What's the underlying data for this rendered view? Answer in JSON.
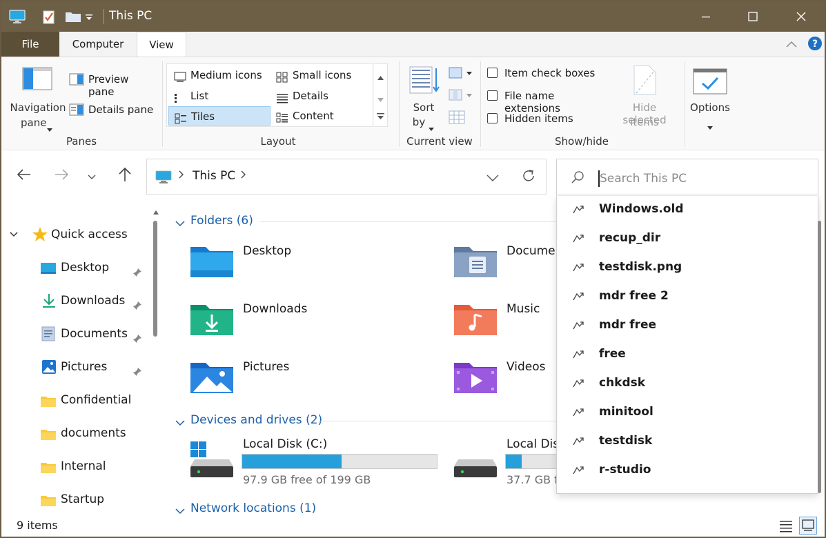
{
  "window": {
    "title": "This PC"
  },
  "ribbon_tabs": {
    "file": "File",
    "computer": "Computer",
    "view": "View"
  },
  "ribbon": {
    "panes": {
      "navigation_pane_line1": "Navigation",
      "navigation_pane_line2": "pane",
      "preview_pane": "Preview pane",
      "details_pane": "Details pane",
      "group_label": "Panes"
    },
    "layout": {
      "medium_icons": "Medium icons",
      "small_icons": "Small icons",
      "list": "List",
      "details": "Details",
      "tiles": "Tiles",
      "content": "Content",
      "group_label": "Layout",
      "selected": "Tiles"
    },
    "current_view": {
      "sort_line1": "Sort",
      "sort_line2": "by",
      "group_label": "Current view"
    },
    "show_hide": {
      "item_check_boxes": "Item check boxes",
      "file_name_extensions": "File name extensions",
      "hidden_items": "Hidden items",
      "hide_selected_line1": "Hide selected",
      "hide_selected_line2": "items",
      "group_label": "Show/hide"
    },
    "options": {
      "label": "Options"
    }
  },
  "address": {
    "location": "This PC"
  },
  "search": {
    "placeholder": "Search This PC"
  },
  "nav_pane": {
    "quick_access": "Quick access",
    "items": [
      {
        "label": "Desktop",
        "pinned": true
      },
      {
        "label": "Downloads",
        "pinned": true
      },
      {
        "label": "Documents",
        "pinned": true
      },
      {
        "label": "Pictures",
        "pinned": true
      },
      {
        "label": "Confidential",
        "pinned": false
      },
      {
        "label": "documents",
        "pinned": false
      },
      {
        "label": "Internal",
        "pinned": false
      },
      {
        "label": "Startup",
        "pinned": false
      }
    ]
  },
  "content": {
    "folders_header": "Folders (6)",
    "folders": [
      "Desktop",
      "Documen",
      "Downloads",
      "Music",
      "Pictures",
      "Videos"
    ],
    "devices_header": "Devices and drives (2)",
    "drives": [
      {
        "name": "Local Disk (C:)",
        "free_text": "97.9 GB free of 199 GB",
        "used_fraction": 0.51
      },
      {
        "name": "Local Dis",
        "free_text": "37.7 GB f",
        "used_fraction": 0.08
      }
    ],
    "network_header": "Network locations (1)"
  },
  "suggestions": [
    "Windows.old",
    "recup_dir",
    "testdisk.png",
    "mdr free 2",
    "mdr free",
    "free",
    "chkdsk",
    "minitool",
    "testdisk",
    "r-studio"
  ],
  "status": {
    "items_count": "9 items"
  },
  "colors": {
    "accent": "#0067c0",
    "drive_fill": "#26a0da",
    "title_bar": "#6c5f45"
  }
}
